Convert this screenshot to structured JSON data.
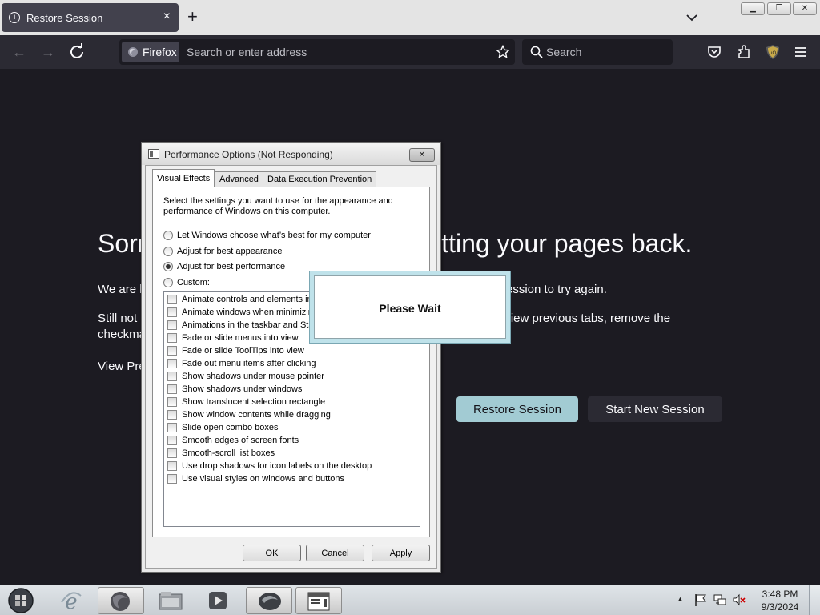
{
  "browser": {
    "tab_title": "Restore Session",
    "tab_close": "×",
    "new_tab": "+",
    "identity_label": "Firefox",
    "url_placeholder": "Search or enter address",
    "search_placeholder": "Search"
  },
  "page": {
    "title": "Sorry. We’re having trouble getting your pages back.",
    "p1": "We are having trouble restoring your last browsing session. Select Restore Session to try again.",
    "p2": "Still not able to restore your session? Sometimes a tab is causing the issue. View previous tabs, remove the checkmark from the tabs you don’t need to recover, and then restore.",
    "view_previous": "View Previous Tabs",
    "restore_button": "Restore Session",
    "new_session_button": "Start New Session"
  },
  "dialog": {
    "title": "Performance Options (Not Responding)",
    "close": "✕",
    "tabs": [
      "Visual Effects",
      "Advanced",
      "Data Execution Prevention"
    ],
    "description": "Select the settings you want to use for the appearance and performance of Windows on this computer.",
    "radios": [
      {
        "label": "Let Windows choose what’s best for my computer",
        "checked": false
      },
      {
        "label": "Adjust for best appearance",
        "checked": false
      },
      {
        "label": "Adjust for best performance",
        "checked": true
      },
      {
        "label": "Custom:",
        "checked": false
      }
    ],
    "effects": [
      "Animate controls and elements inside windows",
      "Animate windows when minimizing and maximizing",
      "Animations in the taskbar and Start Menu",
      "Fade or slide menus into view",
      "Fade or slide ToolTips into view",
      "Fade out menu items after clicking",
      "Show shadows under mouse pointer",
      "Show shadows under windows",
      "Show translucent selection rectangle",
      "Show window contents while dragging",
      "Slide open combo boxes",
      "Smooth edges of screen fonts",
      "Smooth-scroll list boxes",
      "Use drop shadows for icon labels on the desktop",
      "Use visual styles on windows and buttons"
    ],
    "ok": "OK",
    "cancel": "Cancel",
    "apply": "Apply"
  },
  "popup": {
    "text": "Please Wait"
  },
  "taskbar": {
    "time": "3:48 PM",
    "date": "9/3/2024"
  },
  "colors": {
    "page_bg": "#1c1b22",
    "restore_button": "#a2cbd3",
    "new_session_button": "#2b2a33"
  }
}
